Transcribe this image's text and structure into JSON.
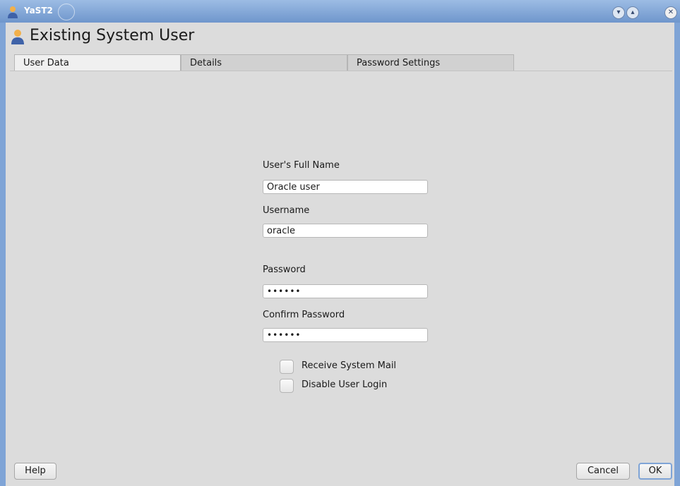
{
  "window": {
    "title": "YaST2",
    "controls": [
      "chevron-down-icon",
      "chevron-up-icon",
      "close-icon"
    ]
  },
  "header": {
    "title": "Existing System User",
    "icon": "user-icon"
  },
  "tabs": [
    {
      "label": "User Data",
      "active": true
    },
    {
      "label": "Details",
      "active": false
    },
    {
      "label": "Password Settings",
      "active": false
    }
  ],
  "form": {
    "full_name": {
      "label": "User's Full Name",
      "value": "Oracle user"
    },
    "username": {
      "label": "Username",
      "value": "oracle"
    },
    "password": {
      "label": "Password",
      "value": "••••••"
    },
    "confirm_password": {
      "label": "Confirm Password",
      "value": "••••••"
    },
    "receive_mail": {
      "label": "Receive System Mail",
      "checked": false
    },
    "disable_login": {
      "label": "Disable User Login",
      "checked": false
    }
  },
  "buttons": {
    "help": "Help",
    "cancel": "Cancel",
    "ok": "OK"
  },
  "colors": {
    "titlebar": "#7fa4d6",
    "background": "#dcdcdc",
    "default_button_border": "#7fa4d6"
  }
}
